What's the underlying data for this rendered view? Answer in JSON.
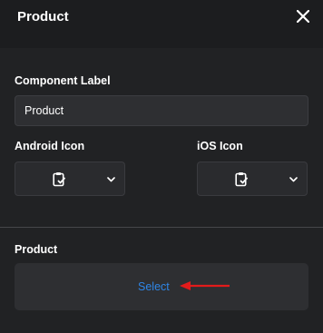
{
  "header": {
    "title": "Product",
    "close_icon": "close-icon"
  },
  "component_label": {
    "label": "Component Label",
    "value": "Product"
  },
  "android_icon": {
    "label": "Android Icon",
    "selected_icon": "clipboard-check-icon"
  },
  "ios_icon": {
    "label": "iOS Icon",
    "selected_icon": "clipboard-check-icon"
  },
  "product": {
    "label": "Product",
    "select_label": "Select"
  },
  "colors": {
    "background": "#212224",
    "header_background": "#1c1d1f",
    "input_background": "#2e2f32",
    "link": "#2f86e6",
    "annotation_arrow": "#e21b1b"
  }
}
